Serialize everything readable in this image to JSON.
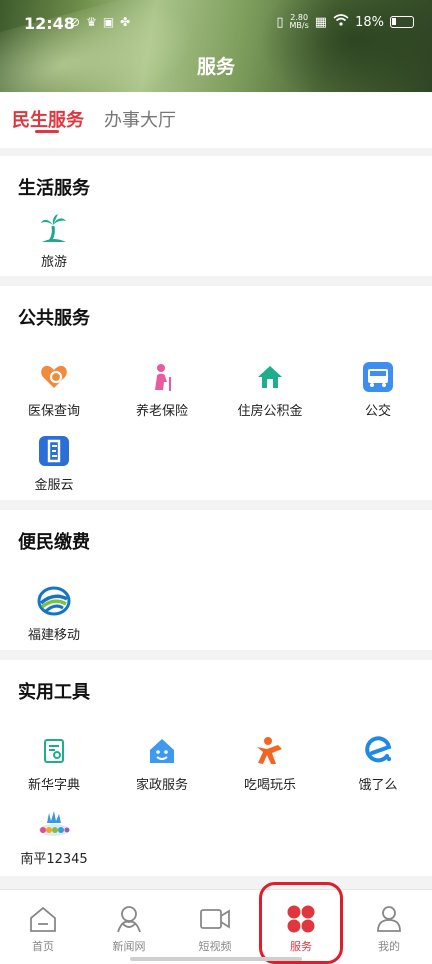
{
  "status_bar": {
    "time": "12:48",
    "net_speed_top": "2.80",
    "net_speed_bottom": "MB/s",
    "battery": "18%"
  },
  "header": {
    "title": "服务"
  },
  "tabs": [
    {
      "label": "民生服务",
      "active": true
    },
    {
      "label": "办事大厅",
      "active": false
    }
  ],
  "sections": {
    "life": {
      "title": "生活服务",
      "items": [
        {
          "label": "旅游",
          "icon": "palm-tree-icon"
        }
      ]
    },
    "public": {
      "title": "公共服务",
      "items": [
        {
          "label": "医保查询",
          "icon": "medical-search-icon"
        },
        {
          "label": "养老保险",
          "icon": "elder-icon"
        },
        {
          "label": "住房公积金",
          "icon": "house-icon"
        },
        {
          "label": "公交",
          "icon": "bus-icon"
        },
        {
          "label": "金服云",
          "icon": "jinfuyun-icon"
        }
      ]
    },
    "payment": {
      "title": "便民缴费",
      "items": [
        {
          "label": "福建移动",
          "icon": "china-mobile-icon"
        }
      ]
    },
    "tools": {
      "title": "实用工具",
      "items": [
        {
          "label": "新华字典",
          "icon": "dictionary-icon"
        },
        {
          "label": "家政服务",
          "icon": "home-service-icon"
        },
        {
          "label": "吃喝玩乐",
          "icon": "leisure-icon"
        },
        {
          "label": "饿了么",
          "icon": "eleme-icon"
        },
        {
          "label": "南平12345",
          "icon": "nanping-12345-icon"
        }
      ]
    }
  },
  "bottom_nav": [
    {
      "label": "首页",
      "icon": "home-icon"
    },
    {
      "label": "新闻网",
      "icon": "news-icon"
    },
    {
      "label": "短视频",
      "icon": "video-icon"
    },
    {
      "label": "服务",
      "icon": "service-icon",
      "active": true
    },
    {
      "label": "我的",
      "icon": "profile-icon"
    }
  ],
  "colors": {
    "accent": "#e0373f",
    "highlight_box": "#e11d2a"
  }
}
